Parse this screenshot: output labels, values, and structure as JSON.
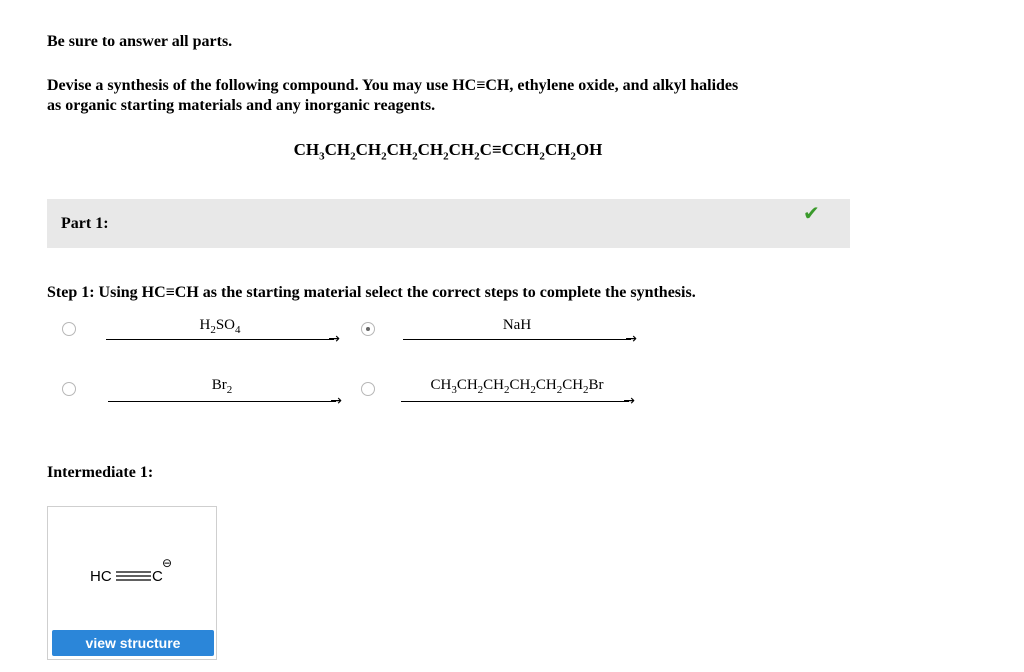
{
  "header": {
    "instructions": "Be sure to answer all parts.",
    "question_line1": "Devise a synthesis of the following compound. You may use HC≡CH, ethylene oxide, and alkyl halides",
    "question_line2": "as organic starting materials and any inorganic reagents."
  },
  "target_compound": {
    "pre": "CH",
    "parts": [
      "3",
      "CH",
      "2",
      "CH",
      "2",
      "CH",
      "2",
      "CH",
      "2",
      "CH",
      "2",
      "C≡CCH",
      "2",
      "CH",
      "2",
      "OH"
    ]
  },
  "part": {
    "label": "Part 1:",
    "status": "correct",
    "check_icon": "checkmark-icon",
    "check_color": "#3a9a2b"
  },
  "step": {
    "text": "Step 1: Using HC≡CH as the starting material select the correct steps to complete the synthesis."
  },
  "options": {
    "h2so4": {
      "main": "H",
      "sub": "2",
      "rest": "SO",
      "sub2": "4",
      "selected": false
    },
    "nah": {
      "label": "NaH",
      "selected": true
    },
    "br2": {
      "main": "Br",
      "sub": "2",
      "selected": false
    },
    "alkyl_bromide": {
      "segments": [
        "CH",
        "3",
        "CH",
        "2",
        "CH",
        "2",
        "CH",
        "2",
        "CH",
        "2",
        "CH",
        "2",
        "Br"
      ],
      "selected": false
    }
  },
  "intermediate": {
    "label": "Intermediate 1:",
    "structure_left": "HC",
    "structure_right": "C",
    "charge": "⊖",
    "button_label": "view structure",
    "button_color": "#2b86d9"
  }
}
